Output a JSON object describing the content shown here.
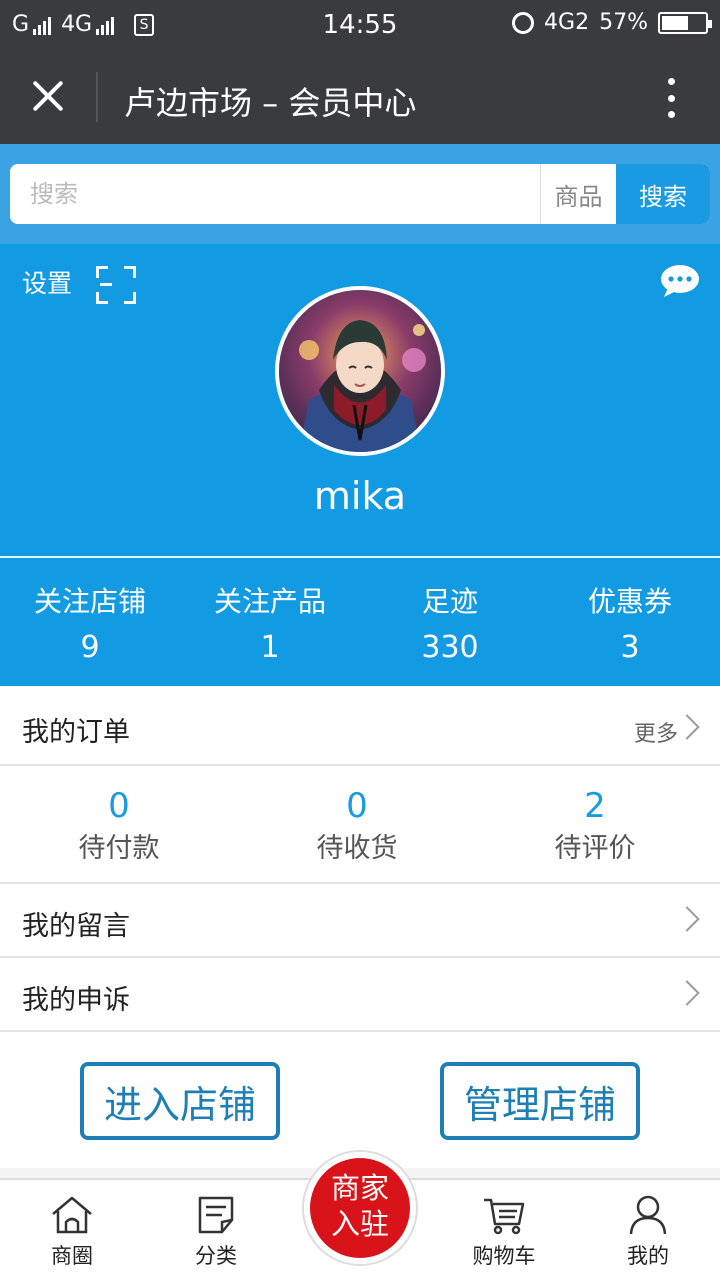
{
  "status_bar": {
    "carrier_left": "G",
    "network": "4G",
    "sim_label": "S",
    "time": "14:55",
    "network_right": "4G2",
    "battery": "57%"
  },
  "header": {
    "title": "卢边市场 – 会员中心"
  },
  "search": {
    "placeholder": "搜索",
    "scope": "商品",
    "button": "搜索"
  },
  "profile": {
    "settings_label": "设置",
    "username": "mika"
  },
  "stats": [
    {
      "label": "关注店铺",
      "value": "9"
    },
    {
      "label": "关注产品",
      "value": "1"
    },
    {
      "label": "足迹",
      "value": "330"
    },
    {
      "label": "优惠券",
      "value": "3"
    }
  ],
  "orders": {
    "title": "我的订单",
    "more": "更多",
    "items": [
      {
        "count": "0",
        "label": "待付款"
      },
      {
        "count": "0",
        "label": "待收货"
      },
      {
        "count": "2",
        "label": "待评价"
      }
    ]
  },
  "menu": [
    {
      "label": "我的留言"
    },
    {
      "label": "我的申诉"
    }
  ],
  "shop_buttons": {
    "enter": "进入店铺",
    "manage": "管理店铺"
  },
  "bottom_nav": {
    "items": [
      {
        "label": "商圈",
        "icon": "home-icon"
      },
      {
        "label": "分类",
        "icon": "category-icon"
      },
      {
        "label": "购物车",
        "icon": "cart-icon"
      },
      {
        "label": "我的",
        "icon": "user-icon"
      }
    ],
    "center_line1": "商家",
    "center_line2": "入驻"
  },
  "colors": {
    "primary_blue": "#129be3",
    "accent_blue": "#1a9ae1",
    "dark_bar": "#3a3b3d",
    "center_red": "#d8141a"
  }
}
